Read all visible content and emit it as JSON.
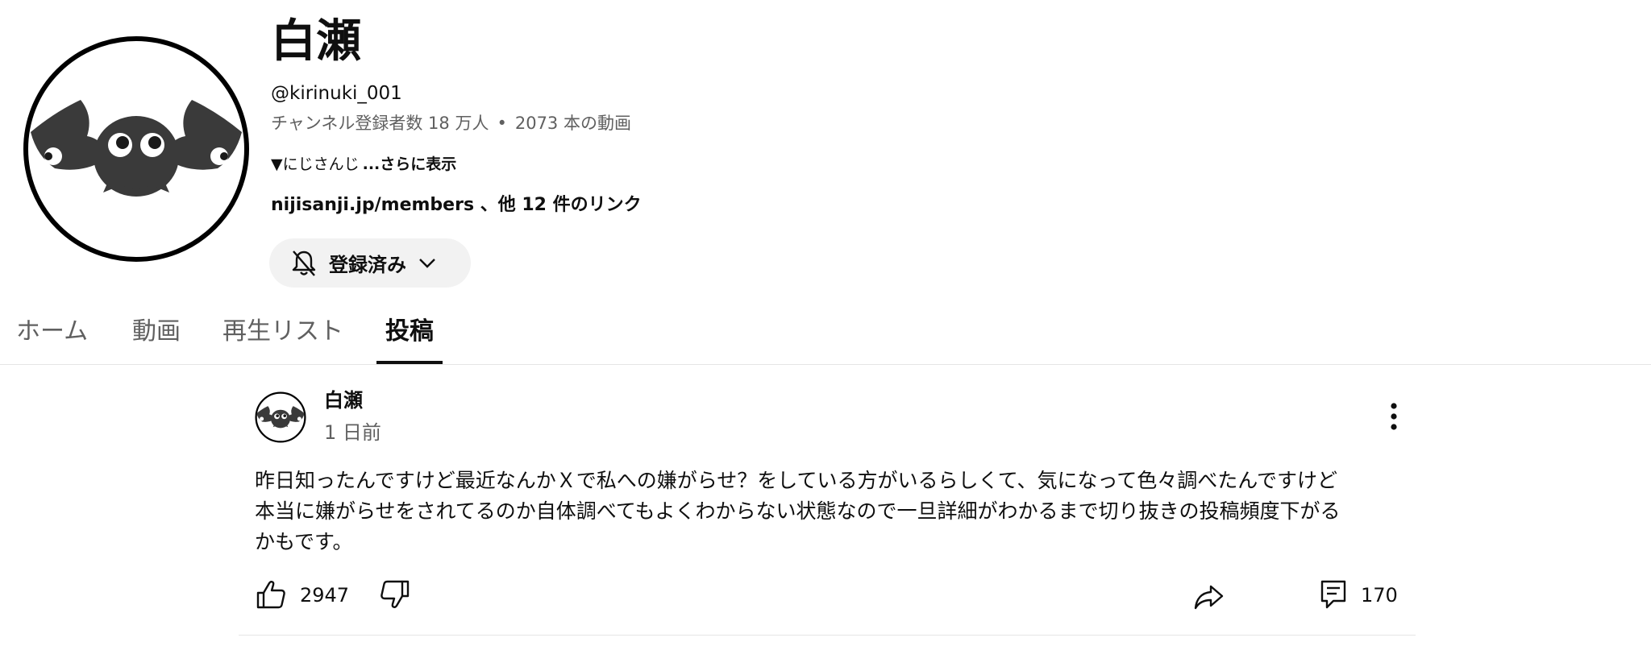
{
  "channel": {
    "name": "白瀬",
    "handle": "@kirinuki_001",
    "subscribers": "チャンネル登録者数 18 万人",
    "separator": "•",
    "video_count": "2073 本の動画",
    "description": "▼にじさんじ",
    "more_label": "...さらに表示",
    "links": "nijisanji.jp/members 、他 12 件のリンク",
    "subscribe_label": "登録済み",
    "avatar_icon": "bat-mascot-icon"
  },
  "tabs": [
    {
      "label": "ホーム",
      "active": false
    },
    {
      "label": "動画",
      "active": false
    },
    {
      "label": "再生リスト",
      "active": false
    },
    {
      "label": "投稿",
      "active": true
    }
  ],
  "post": {
    "author": "白瀬",
    "time": "1 日前",
    "body_lines": [
      "昨日知ったんですけど最近なんかＸで私への嫌がらせ？をしている方がいるらしくて、気になって色々調べたんですけど",
      "本当に嫌がらせをされてるのか自体調べてもよくわからない状態なので一旦詳細がわかるまで切り抜きの投稿頻度下がる",
      "かもです。"
    ],
    "likes": "2947",
    "comments": "170"
  },
  "colors": {
    "text": "#0f0f0f",
    "secondary_text": "#606060",
    "button_bg": "#f2f2f2",
    "divider": "#e5e5e5"
  }
}
